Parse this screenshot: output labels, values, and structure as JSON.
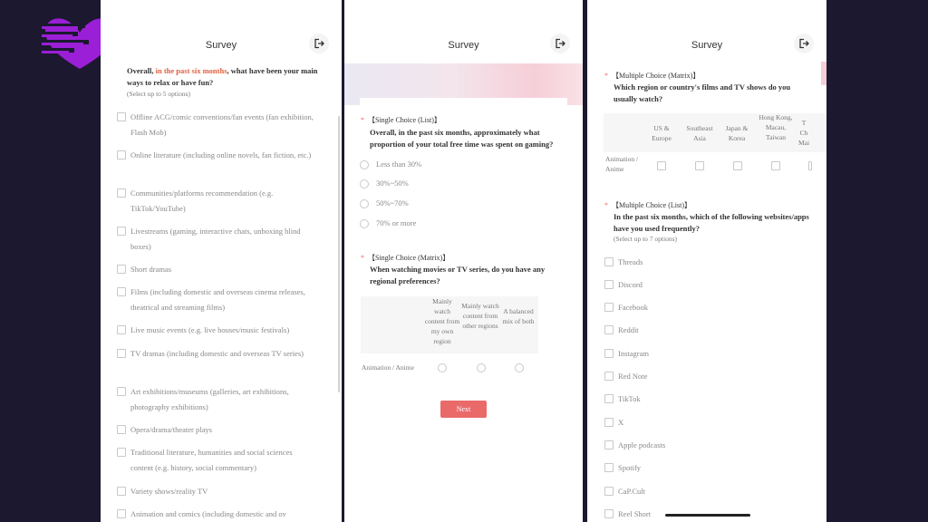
{
  "colors": {
    "accent": "#ea6a6a",
    "highlight": "#e06040",
    "logo": "#9b1fd6"
  },
  "header": {
    "title": "Survey",
    "exit_icon": "logout-icon"
  },
  "panel1": {
    "q_prefix": "Overall, ",
    "q_highlight": "in the past six months",
    "q_suffix": ", what have been your main ways to relax or have fun?",
    "hint": "(Select up to 5 options)",
    "options": [
      "Offline ACG/comic conventions/fan events (fan exhibition, Flash Mob)",
      "Online literature (including online novels, fan fiction, etc.)",
      "Communities/platforms recommendation (e.g. TikTok/YouTube)",
      "Livestreams (gaming, interactive chats, unboxing blind boxes)",
      "Short dramas",
      "Films (including domestic and overseas cinema releases, theatrical and streaming films)",
      "Live music events (e.g. live houses/music festivals)",
      "TV dramas (including domestic and overseas TV series)",
      "Art exhibitions/museums (galleries, art exhibitions, photography exhibitions)",
      "Opera/drama/theater plays",
      "Traditional literature, humanities and social sciences content (e.g. history, social commentary)",
      "Variety shows/reality TV",
      "Animation and comics (including domestic and ov"
    ]
  },
  "panel2": {
    "q1_tag": "【Single Choice (List)】",
    "q1_title": "Overall, in the past six months, approximately what proportion of your total free time was spent on gaming?",
    "q1_options": [
      "Less than 30%",
      "30%~50%",
      "50%~70%",
      "70% or more"
    ],
    "q2_tag": "【Single Choice (Matrix)】",
    "q2_title": "When watching movies or TV series, do you have any regional preferences?",
    "q2_cols": [
      "Mainly watch content from my own region",
      "Mainly watch content from other regions",
      "A balanced mix of both"
    ],
    "q2_row": "Animation / Anime",
    "next_label": "Next"
  },
  "panel3": {
    "q1_tag": "【Multiple Choice (Matrix)】",
    "q1_title": "Which region or country's films and TV shows do you usually watch?",
    "q1_cols": [
      "US & Europe",
      "Southeast Asia",
      "Japan & Korea",
      "Hong Kong, Macau, Taiwan",
      "T Ch Mai"
    ],
    "q1_row": "Animation / Anime",
    "q2_tag": "【Multiple Choice (List)】",
    "q2_title": "In the past six months, which of the following websites/apps have you used frequently?",
    "q2_hint": "(Select up to 7 options)",
    "q2_options": [
      "Threads",
      "Discord",
      "Facebook",
      "Reddit",
      "Instagram",
      "Red Note",
      "TikTok",
      "X",
      "Apple podcasts",
      "Spotify",
      "CaP.Cult",
      "Reel Short"
    ]
  }
}
